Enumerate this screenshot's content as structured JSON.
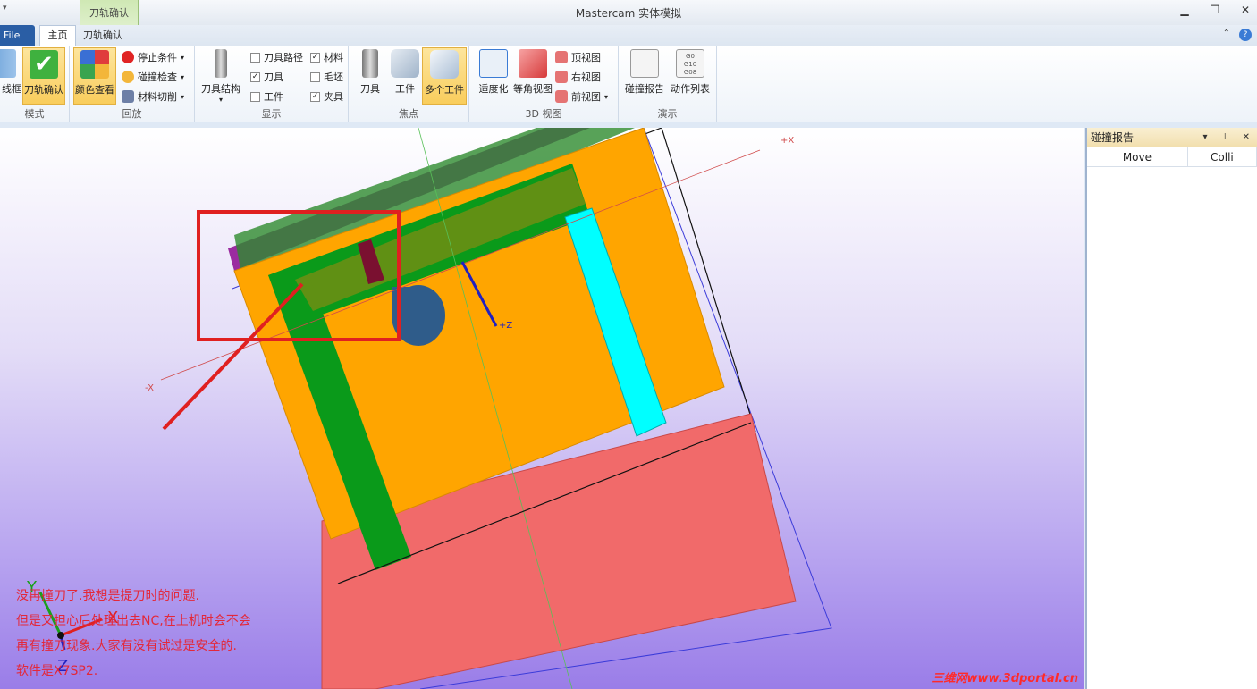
{
  "window": {
    "title": "Mastercam 实体模拟",
    "context_group_label": "刀轨确认",
    "quick_access": "▾"
  },
  "tabs": {
    "file": "File",
    "home": "主页",
    "verify": "刀轨确认"
  },
  "ribbon": {
    "groups": {
      "mode": {
        "label": "模式",
        "buttons": [
          "线框",
          "刀轨确认"
        ]
      },
      "playback": {
        "label": "回放",
        "big_button": "颜色查看",
        "items": [
          "停止条件",
          "碰撞检查",
          "材料切削"
        ]
      },
      "display": {
        "label": "显示",
        "big_button": "刀具结构",
        "checks": [
          {
            "label": "刀具路径",
            "checked": false
          },
          {
            "label": "刀具",
            "checked": true
          },
          {
            "label": "工件",
            "checked": false
          },
          {
            "label": "材料",
            "checked": true
          },
          {
            "label": "毛坯",
            "checked": false
          },
          {
            "label": "夹具",
            "checked": true
          }
        ]
      },
      "focus": {
        "label": "焦点",
        "buttons": [
          "刀具",
          "工件",
          "多个工件"
        ]
      },
      "view3d": {
        "label": "3D 视图",
        "buttons": [
          "适度化",
          "等角视图"
        ],
        "items": [
          "顶视图",
          "右视图",
          "前视图"
        ]
      },
      "demo": {
        "label": "演示",
        "buttons": [
          "碰撞报告",
          "动作列表"
        ]
      }
    }
  },
  "viewport": {
    "axis_labels": {
      "plus_x": "+X",
      "minus_x": "-X",
      "plus_z": "+Z",
      "triad_x": "X",
      "triad_y": "Y",
      "triad_z": "Z"
    },
    "note_lines": [
      "没再撞刀了.我想是提刀时的问题.",
      "但是又担心后处理出去NC,在上机时会不会",
      "再有撞刀现象.大家有没有试过是安全的.",
      "软件是X7SP2."
    ],
    "watermark": "三维网www.3dportal.cn"
  },
  "panel": {
    "title": "碰撞报告",
    "buttons": "▾ ⊥ ✕",
    "columns": [
      "Move",
      "Colli"
    ]
  },
  "colors": {
    "accent": "#2a5ea5",
    "orange": "#ffa500",
    "green": "#0a9a1a",
    "cyan": "#00ffff",
    "salmon": "#f16a6a",
    "purple": "#9b2ca0",
    "annotation_red": "#e3283a"
  }
}
